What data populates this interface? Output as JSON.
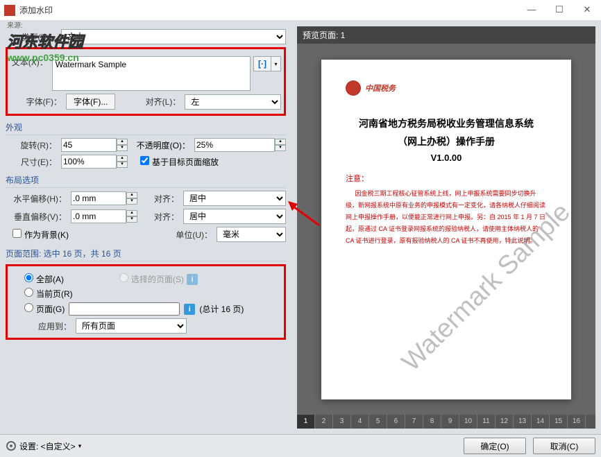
{
  "window": {
    "title": "添加水印",
    "source_label": "来源:"
  },
  "logo": {
    "text": "河东软件园",
    "url": "www.pc0359.cn"
  },
  "type": {
    "label": "类型(T)：",
    "value": "文本"
  },
  "text": {
    "label": "文本(X)：",
    "value": "Watermark Sample",
    "dyn": "[·]"
  },
  "font": {
    "label": "字体(F)：",
    "button": "字体(F)..."
  },
  "align_text": {
    "label": "对齐(L)：",
    "value": "左"
  },
  "appearance": {
    "header": "外观",
    "rotate": {
      "label": "旋转(R)：",
      "value": "45"
    },
    "opacity": {
      "label": "不透明度(O)：",
      "value": "25%"
    },
    "scale": {
      "label": "尺寸(E)：",
      "value": "100%"
    },
    "relative": "基于目标页面缩放"
  },
  "layout": {
    "header": "布局选项",
    "hoffset": {
      "label": "水平偏移(H)：",
      "value": ".0 mm"
    },
    "voffset": {
      "label": "垂直偏移(V)：",
      "value": ".0 mm"
    },
    "align1": {
      "label": "对齐：",
      "value": "居中"
    },
    "align2": {
      "label": "对齐：",
      "value": "居中"
    },
    "as_bg": "作为背景(K)",
    "unit": {
      "label": "单位(U)：",
      "value": "毫米"
    }
  },
  "range": {
    "header": "页面范围: 选中 16 页，共 16 页",
    "all": "全部(A)",
    "selected": "选择的页面(S)",
    "current": "当前页(R)",
    "pages": "页面(G)",
    "total": "(总计 16 页)",
    "apply_label": "应用到：",
    "apply_value": "所有页面"
  },
  "preview": {
    "header": "预览页面: 1",
    "logo_text": "中国税务",
    "title1": "河南省地方税务局税收业务管理信息系统",
    "title2": "（网上办税）操作手册",
    "version": "V1.0.00",
    "notice_title": "注意：",
    "notice_body": "因金税三期工程核心征管系统上线，网上申报系统需要同步切换升级，新网报系统中原有业务的申报模式有一定变化，请各纳税人仔细阅读网上申报操作手册，以便能正常进行网上申报。另：自 2015 年 1 月 7 日起，原通过 CA 证书登录网报系统的报验纳税人，请使用主体纳税人的 CA 证书进行登录，原有报验纳税人的 CA 证书不再使用，特此说明。",
    "watermark": "Watermark Sample",
    "pages": [
      "1",
      "2",
      "3",
      "4",
      "5",
      "6",
      "7",
      "8",
      "9",
      "10",
      "11",
      "12",
      "13",
      "14",
      "15",
      "16"
    ]
  },
  "footer": {
    "settings": "设置: <自定义>",
    "ok": "确定(O)",
    "cancel": "取消(C)"
  }
}
